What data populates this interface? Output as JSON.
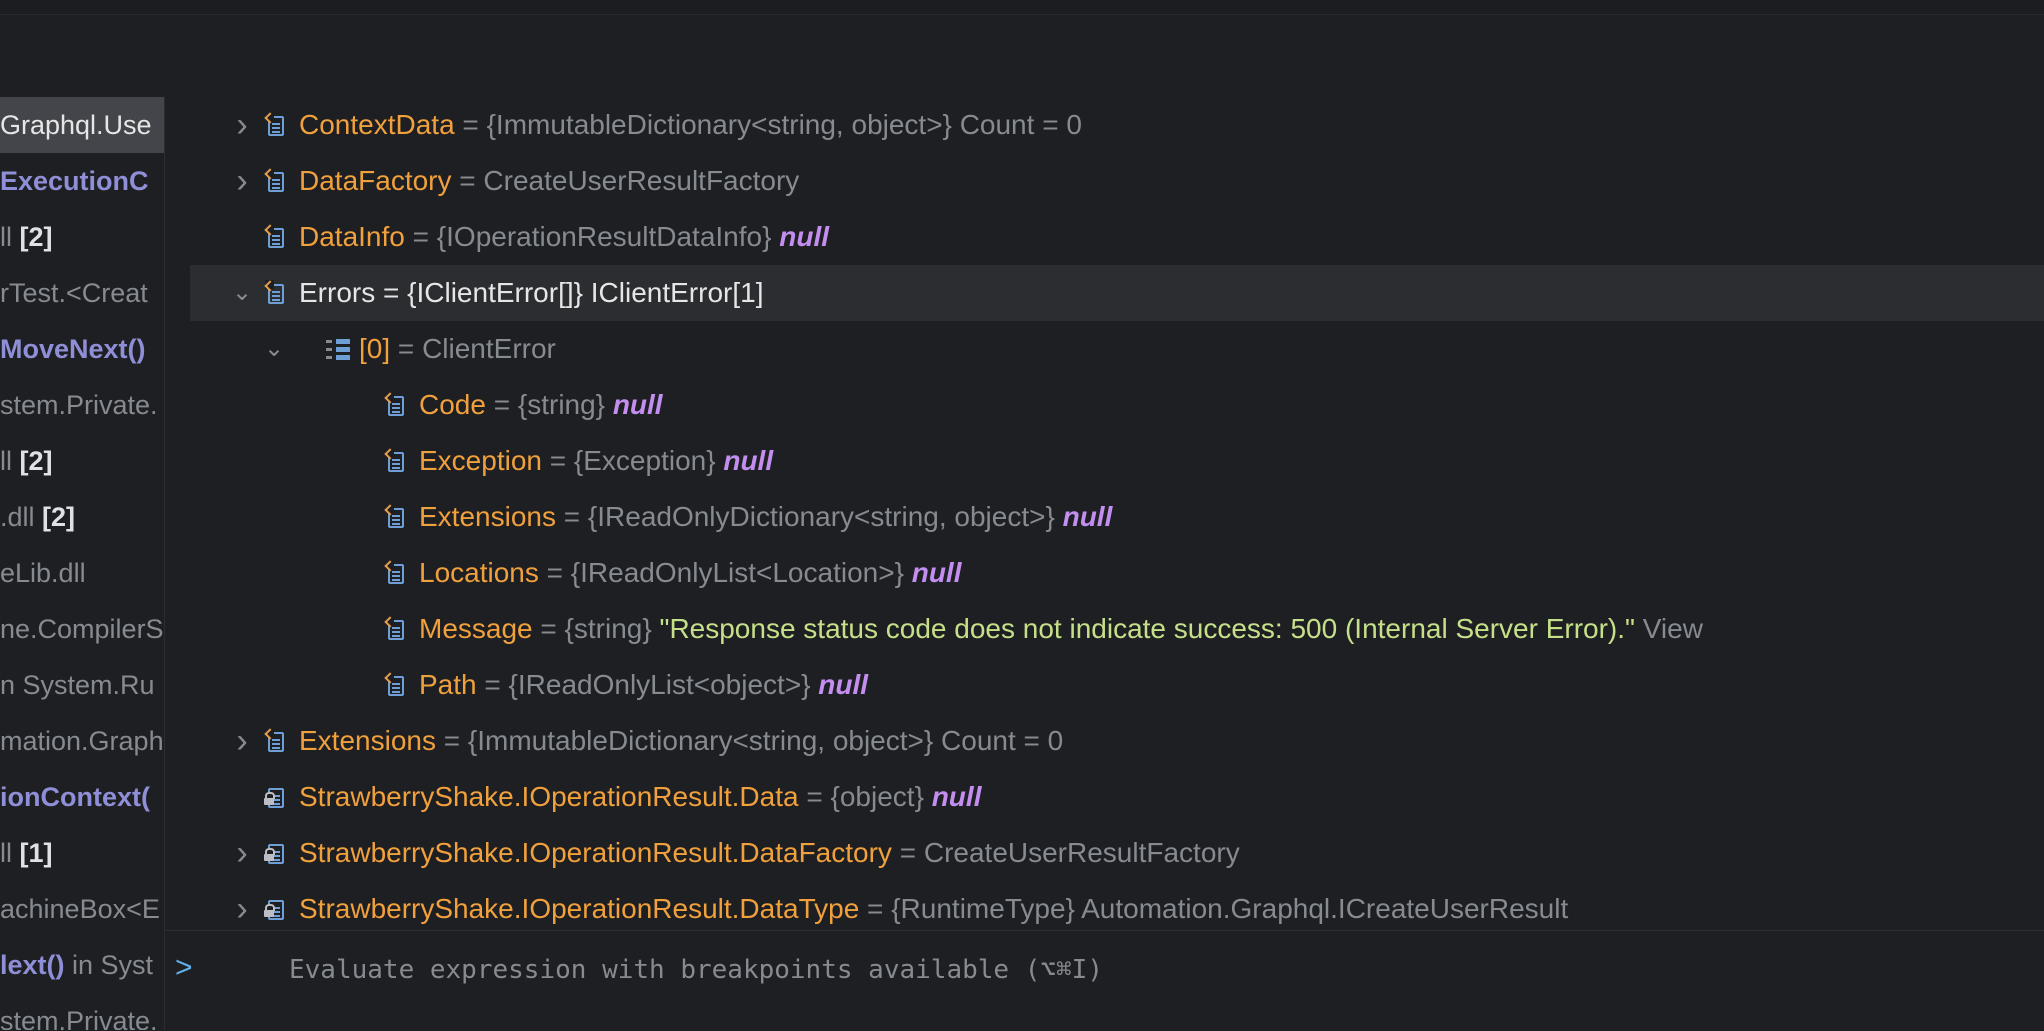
{
  "frames": [
    {
      "pre": "Graphql.Use",
      "bold": "",
      "post": "",
      "selected": true
    },
    {
      "pre": "",
      "bold": "ExecutionC",
      "post": "",
      "selected": false
    },
    {
      "pre": "ll ",
      "bold": "[2]",
      "post": "",
      "selected": false
    },
    {
      "pre": "rTest.<Creat",
      "bold": "",
      "post": "",
      "selected": false
    },
    {
      "pre": "",
      "bold": "MoveNext",
      "post": "()",
      "selected": false
    },
    {
      "pre": "stem.Private.",
      "bold": "",
      "post": "",
      "selected": false
    },
    {
      "pre": "ll ",
      "bold": "[2]",
      "post": "",
      "selected": false
    },
    {
      "pre": ".dll ",
      "bold": "[2]",
      "post": "",
      "selected": false
    },
    {
      "pre": "eLib.dll",
      "bold": "",
      "post": "",
      "selected": false
    },
    {
      "pre": "ne.CompilerS",
      "bold": "",
      "post": "",
      "selected": false
    },
    {
      "pre": "n System.Ru",
      "bold": "",
      "post": "",
      "selected": false
    },
    {
      "pre": "mation.Graph",
      "bold": "",
      "post": "",
      "selected": false
    },
    {
      "pre": "",
      "bold": "ionContext(",
      "post": "",
      "selected": false
    },
    {
      "pre": "ll ",
      "bold": "[1]",
      "post": "",
      "selected": false
    },
    {
      "pre": "achineBox<E",
      "bold": "",
      "post": "",
      "selected": false
    },
    {
      "pre": "",
      "bold": "lext()",
      "post": " in Syst",
      "selected": false
    },
    {
      "pre": "stem.Private.",
      "bold": "",
      "post": "",
      "selected": false
    }
  ],
  "variables": [
    {
      "arrow": "›",
      "icon": "field",
      "name": "ContextData",
      "eq": " = ",
      "type": "{ImmutableDictionary<string, object>} Count = 0",
      "value": "",
      "valueKind": "",
      "extra": ""
    },
    {
      "arrow": "›",
      "icon": "field",
      "name": "DataFactory",
      "eq": " = ",
      "type": "CreateUserResultFactory",
      "value": "",
      "valueKind": "",
      "extra": ""
    },
    {
      "arrow": "",
      "icon": "field",
      "name": "DataInfo",
      "eq": " = ",
      "type": "{IOperationResultDataInfo} ",
      "value": "null",
      "valueKind": "null",
      "extra": ""
    },
    {
      "arrow": "⌄",
      "icon": "field",
      "name": "Errors = {IClientError[]} IClientError[1]",
      "eq": "",
      "type": "",
      "value": "",
      "valueKind": "",
      "extra": "",
      "selected": true
    },
    {
      "arrow": "⌄",
      "icon": "list",
      "name": "[0]",
      "eq": " = ",
      "type": "ClientError",
      "value": "",
      "valueKind": "",
      "extra": ""
    },
    {
      "arrow": "",
      "icon": "field",
      "name": "Code",
      "eq": " = ",
      "type": "{string} ",
      "value": "null",
      "valueKind": "null",
      "extra": ""
    },
    {
      "arrow": "",
      "icon": "field",
      "name": "Exception",
      "eq": " = ",
      "type": "{Exception} ",
      "value": "null",
      "valueKind": "null",
      "extra": ""
    },
    {
      "arrow": "",
      "icon": "field",
      "name": "Extensions",
      "eq": " = ",
      "type": "{IReadOnlyDictionary<string, object>} ",
      "value": "null",
      "valueKind": "null",
      "extra": ""
    },
    {
      "arrow": "",
      "icon": "field",
      "name": "Locations",
      "eq": " = ",
      "type": "{IReadOnlyList<Location>} ",
      "value": "null",
      "valueKind": "null",
      "extra": ""
    },
    {
      "arrow": "",
      "icon": "field",
      "name": "Message",
      "eq": " = ",
      "type": "{string} ",
      "value": "\"Response status code does not indicate success: 500 (Internal Server Error).\"",
      "valueKind": "string",
      "extra": " View"
    },
    {
      "arrow": "",
      "icon": "field",
      "name": "Path",
      "eq": " = ",
      "type": "{IReadOnlyList<object>} ",
      "value": "null",
      "valueKind": "null",
      "extra": ""
    },
    {
      "arrow": "›",
      "icon": "field",
      "name": "Extensions",
      "eq": " = ",
      "type": "{ImmutableDictionary<string, object>} Count = 0",
      "value": "",
      "valueKind": "",
      "extra": ""
    },
    {
      "arrow": "",
      "icon": "locked",
      "name": "StrawberryShake.IOperationResult.Data",
      "eq": " = ",
      "type": "{object} ",
      "value": "null",
      "valueKind": "null",
      "extra": ""
    },
    {
      "arrow": "›",
      "icon": "locked",
      "name": "StrawberryShake.IOperationResult.DataFactory",
      "eq": " = ",
      "type": "CreateUserResultFactory",
      "value": "",
      "valueKind": "",
      "extra": ""
    },
    {
      "arrow": "›",
      "icon": "locked",
      "name": "StrawberryShake.IOperationResult.DataType",
      "eq": " = ",
      "type": "{RuntimeType} Automation.Graphql.ICreateUserResult",
      "value": "",
      "valueKind": "",
      "extra": ""
    }
  ],
  "console": {
    "prompt": ">",
    "placeholder": "Evaluate expression with breakpoints available (⌥⌘I)"
  },
  "colors": {
    "background": "#1e1f22",
    "name": "#f0a03c",
    "null": "#c38ef0",
    "string": "#c6e08a",
    "icon": "#6e9fd6"
  }
}
